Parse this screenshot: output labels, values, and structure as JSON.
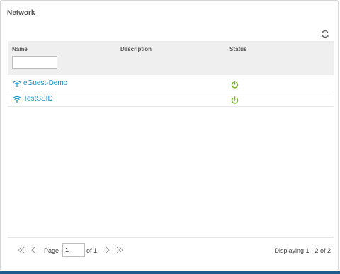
{
  "panel": {
    "title": "Network"
  },
  "columns": {
    "name": "Name",
    "description": "Description",
    "status": "Status"
  },
  "filter": {
    "value": "",
    "placeholder": ""
  },
  "rows": [
    {
      "name": "eGuest-Demo",
      "description": "",
      "status": "power-on-icon"
    },
    {
      "name": "TestSSID",
      "description": "",
      "status": "power-on-icon"
    }
  ],
  "pager": {
    "page_label": "Page",
    "page_value": "1",
    "of_label": "of 1",
    "displaying": "Displaying 1 - 2 of 2"
  },
  "colors": {
    "link": "#1a8fbf",
    "status_on": "#7ab82a",
    "header_bg": "#efefef",
    "bottom_bar": "#1f5a8c"
  }
}
